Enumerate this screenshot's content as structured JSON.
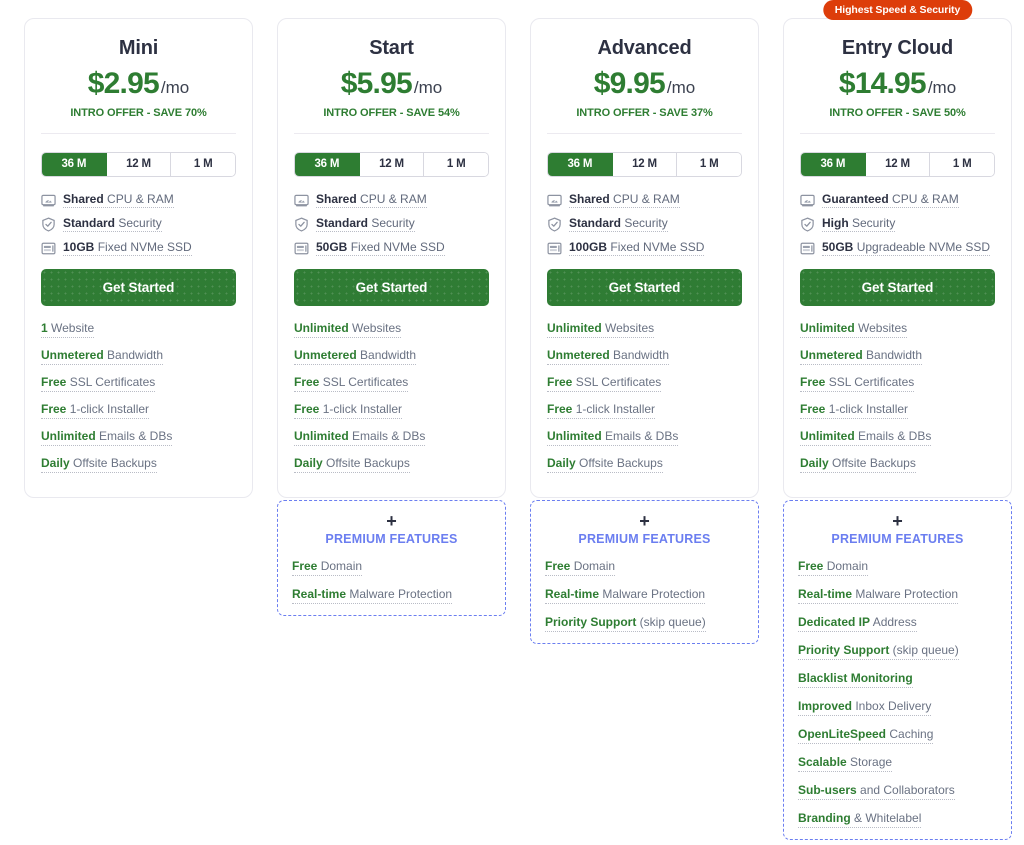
{
  "theme": {
    "brand_green": "#2e7d32",
    "button_green": "#2f7c34",
    "badge_red": "#dd3d0a",
    "premium_blue": "#6b7ef0",
    "title_color": "#2d3142",
    "body_color": "#6a7283"
  },
  "labels": {
    "per_month": "/mo",
    "cta": "Get Started",
    "premium_plus": "+",
    "premium_title": "PREMIUM FEATURES"
  },
  "terms": [
    {
      "label": "36 M",
      "active": true
    },
    {
      "label": "12 M",
      "active": false
    },
    {
      "label": "1 M",
      "active": false
    }
  ],
  "plans": [
    {
      "badge": null,
      "name": "Mini",
      "price": "$2.95",
      "offer": "INTRO OFFER - SAVE 70%",
      "specs": [
        {
          "icon": "gauge-icon",
          "bold": "Shared",
          "rest": " CPU & RAM"
        },
        {
          "icon": "shield-icon",
          "bold": "Standard",
          "rest": " Security"
        },
        {
          "icon": "drive-icon",
          "bold": "10GB",
          "rest": " Fixed NVMe SSD"
        }
      ],
      "features": [
        {
          "bold": "1",
          "rest": " Website"
        },
        {
          "bold": "Unmetered",
          "rest": " Bandwidth"
        },
        {
          "bold": "Free",
          "rest": " SSL Certificates"
        },
        {
          "bold": "Free",
          "rest": " 1-click Installer"
        },
        {
          "bold": "Unlimited",
          "rest": " Emails & DBs"
        },
        {
          "bold": "Daily",
          "rest": " Offsite Backups"
        }
      ],
      "premium": []
    },
    {
      "badge": null,
      "name": "Start",
      "price": "$5.95",
      "offer": "INTRO OFFER - SAVE 54%",
      "specs": [
        {
          "icon": "gauge-icon",
          "bold": "Shared",
          "rest": " CPU & RAM"
        },
        {
          "icon": "shield-icon",
          "bold": "Standard",
          "rest": " Security"
        },
        {
          "icon": "drive-icon",
          "bold": "50GB",
          "rest": " Fixed NVMe SSD"
        }
      ],
      "features": [
        {
          "bold": "Unlimited",
          "rest": " Websites"
        },
        {
          "bold": "Unmetered",
          "rest": " Bandwidth"
        },
        {
          "bold": "Free",
          "rest": " SSL Certificates"
        },
        {
          "bold": "Free",
          "rest": " 1-click Installer"
        },
        {
          "bold": "Unlimited",
          "rest": " Emails & DBs"
        },
        {
          "bold": "Daily",
          "rest": " Offsite Backups"
        }
      ],
      "premium": [
        {
          "bold": "Free",
          "rest": " Domain"
        },
        {
          "bold": "Real-time",
          "rest": " Malware Protection"
        }
      ]
    },
    {
      "badge": null,
      "name": "Advanced",
      "price": "$9.95",
      "offer": "INTRO OFFER - SAVE 37%",
      "specs": [
        {
          "icon": "gauge-icon",
          "bold": "Shared",
          "rest": " CPU & RAM"
        },
        {
          "icon": "shield-icon",
          "bold": "Standard",
          "rest": " Security"
        },
        {
          "icon": "drive-icon",
          "bold": "100GB",
          "rest": " Fixed NVMe SSD"
        }
      ],
      "features": [
        {
          "bold": "Unlimited",
          "rest": " Websites"
        },
        {
          "bold": "Unmetered",
          "rest": " Bandwidth"
        },
        {
          "bold": "Free",
          "rest": " SSL Certificates"
        },
        {
          "bold": "Free",
          "rest": " 1-click Installer"
        },
        {
          "bold": "Unlimited",
          "rest": " Emails & DBs"
        },
        {
          "bold": "Daily",
          "rest": " Offsite Backups"
        }
      ],
      "premium": [
        {
          "bold": "Free",
          "rest": " Domain"
        },
        {
          "bold": "Real-time",
          "rest": " Malware Protection"
        },
        {
          "bold": "Priority Support",
          "rest": " (skip queue)"
        }
      ]
    },
    {
      "badge": "Highest Speed & Security",
      "name": "Entry Cloud",
      "price": "$14.95",
      "offer": "INTRO OFFER - SAVE 50%",
      "specs": [
        {
          "icon": "gauge-icon",
          "bold": "Guaranteed",
          "rest": " CPU & RAM"
        },
        {
          "icon": "shield-icon",
          "bold": "High",
          "rest": " Security"
        },
        {
          "icon": "drive-icon",
          "bold": "50GB",
          "rest": " Upgradeable NVMe SSD"
        }
      ],
      "features": [
        {
          "bold": "Unlimited",
          "rest": " Websites"
        },
        {
          "bold": "Unmetered",
          "rest": " Bandwidth"
        },
        {
          "bold": "Free",
          "rest": " SSL Certificates"
        },
        {
          "bold": "Free",
          "rest": " 1-click Installer"
        },
        {
          "bold": "Unlimited",
          "rest": " Emails & DBs"
        },
        {
          "bold": "Daily",
          "rest": " Offsite Backups"
        }
      ],
      "premium": [
        {
          "bold": "Free",
          "rest": " Domain"
        },
        {
          "bold": "Real-time",
          "rest": " Malware Protection"
        },
        {
          "bold": "Dedicated IP",
          "rest": " Address"
        },
        {
          "bold": "Priority Support",
          "rest": " (skip queue)"
        },
        {
          "bold": "Blacklist Monitoring",
          "rest": ""
        },
        {
          "bold": "Improved",
          "rest": " Inbox Delivery"
        },
        {
          "bold": "OpenLiteSpeed",
          "rest": " Caching"
        },
        {
          "bold": "Scalable",
          "rest": " Storage"
        },
        {
          "bold": "Sub-users",
          "rest": " and Collaborators"
        },
        {
          "bold": "Branding",
          "rest": " & Whitelabel"
        }
      ]
    }
  ]
}
